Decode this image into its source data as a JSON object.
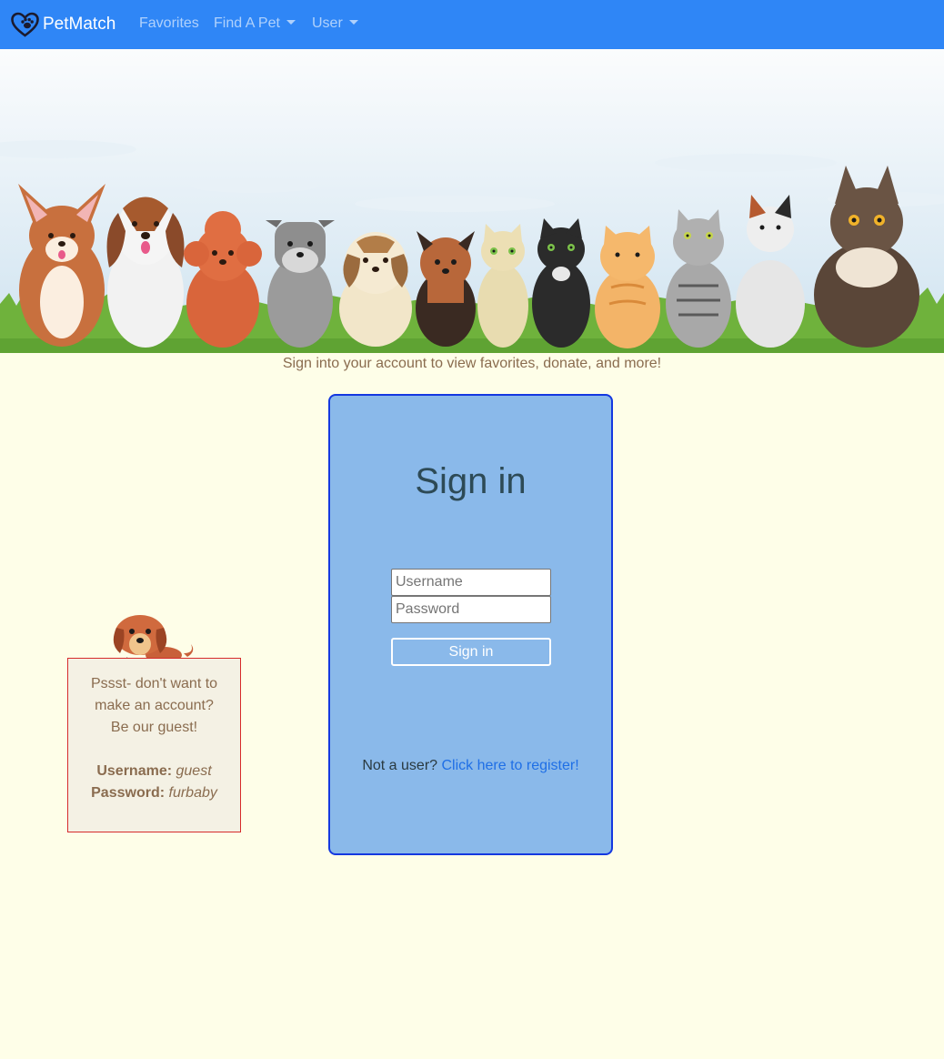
{
  "navbar": {
    "brand": "PetMatch",
    "links": [
      "Favorites",
      "Find A Pet",
      "User"
    ]
  },
  "banner": {
    "alt_icons": [
      "dog-icons",
      "cat-icons"
    ]
  },
  "tagline": "Sign into your account to view favorites, donate, and more!",
  "signin": {
    "title": "Sign in",
    "username_placeholder": "Username",
    "password_placeholder": "Password",
    "button_label": "Sign in",
    "register_prompt": "Not a user?",
    "register_link": "Click here to register!"
  },
  "guest": {
    "line1": "Pssst- don't want to",
    "line2": "make an account?",
    "line3": "Be our guest!",
    "username_label": "Username:",
    "username_value": "guest",
    "password_label": "Password:",
    "password_value": "furbaby"
  },
  "colors": {
    "navbar": "#2f86f6",
    "page_bg": "#fefee8",
    "card_bg": "#8ab9ea",
    "card_border": "#1438e0",
    "link": "#1f6fe6",
    "guest_border": "#d62b2b"
  }
}
